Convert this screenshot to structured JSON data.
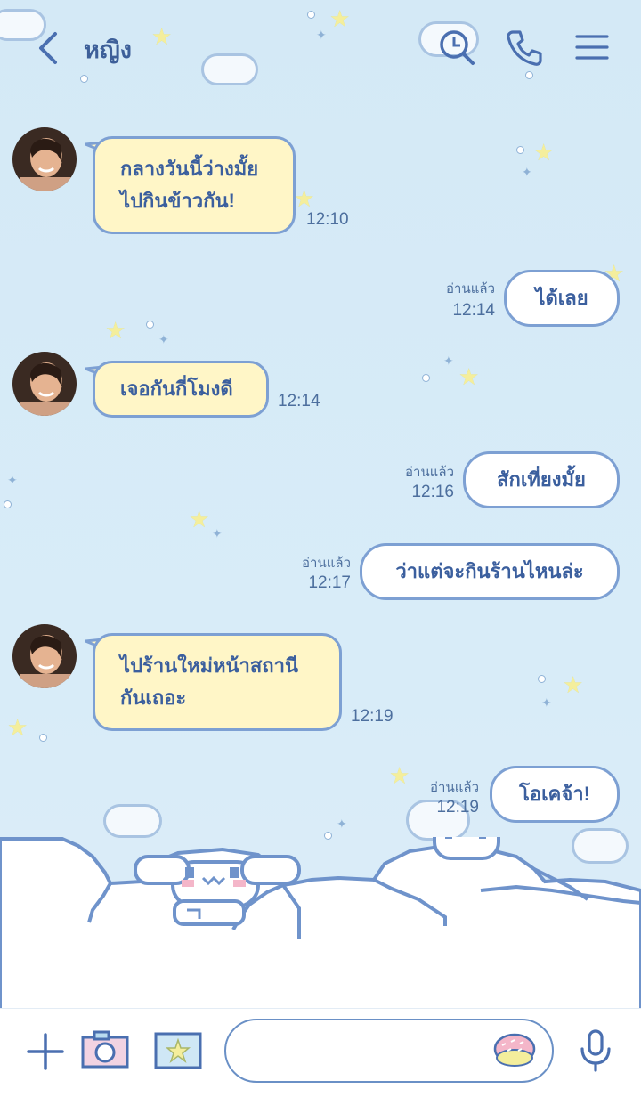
{
  "header": {
    "title": "หญิง"
  },
  "messages": [
    {
      "lines": [
        "กลางวันนี้ว่างมั้ย",
        "ไปกินข้าวกัน!"
      ],
      "time": "12:10"
    },
    {
      "text": "ได้เลย",
      "read": "อ่านแล้ว",
      "time": "12:14"
    },
    {
      "lines": [
        "เจอกันกี่โมงดี"
      ],
      "time": "12:14"
    },
    {
      "text": "สักเที่ยงมั้ย",
      "read": "อ่านแล้ว",
      "time": "12:16"
    },
    {
      "text": "ว่าแต่จะกินร้านไหนล่ะ",
      "read": "อ่านแล้ว",
      "time": "12:17"
    },
    {
      "lines": [
        "ไปร้านใหม่หน้าสถานี",
        "กันเถอะ"
      ],
      "time": "12:19"
    },
    {
      "text": "โอเคจ้า!",
      "read": "อ่านแล้ว",
      "time": "12:19"
    }
  ],
  "input": {
    "placeholder": ""
  },
  "icons": {
    "back": "chevron-left-icon",
    "search": "search-icon",
    "call": "phone-icon",
    "menu": "menu-icon",
    "add": "plus-icon",
    "camera": "camera-icon",
    "photo": "image-icon",
    "sticker": "sticker-icon",
    "mic": "microphone-icon"
  },
  "colors": {
    "background": "#d4e9f6",
    "accent": "#3d5f99",
    "incoming_bubble": "#fff6c7",
    "outgoing_bubble": "#ffffff",
    "bubble_border": "#7da0d3"
  }
}
